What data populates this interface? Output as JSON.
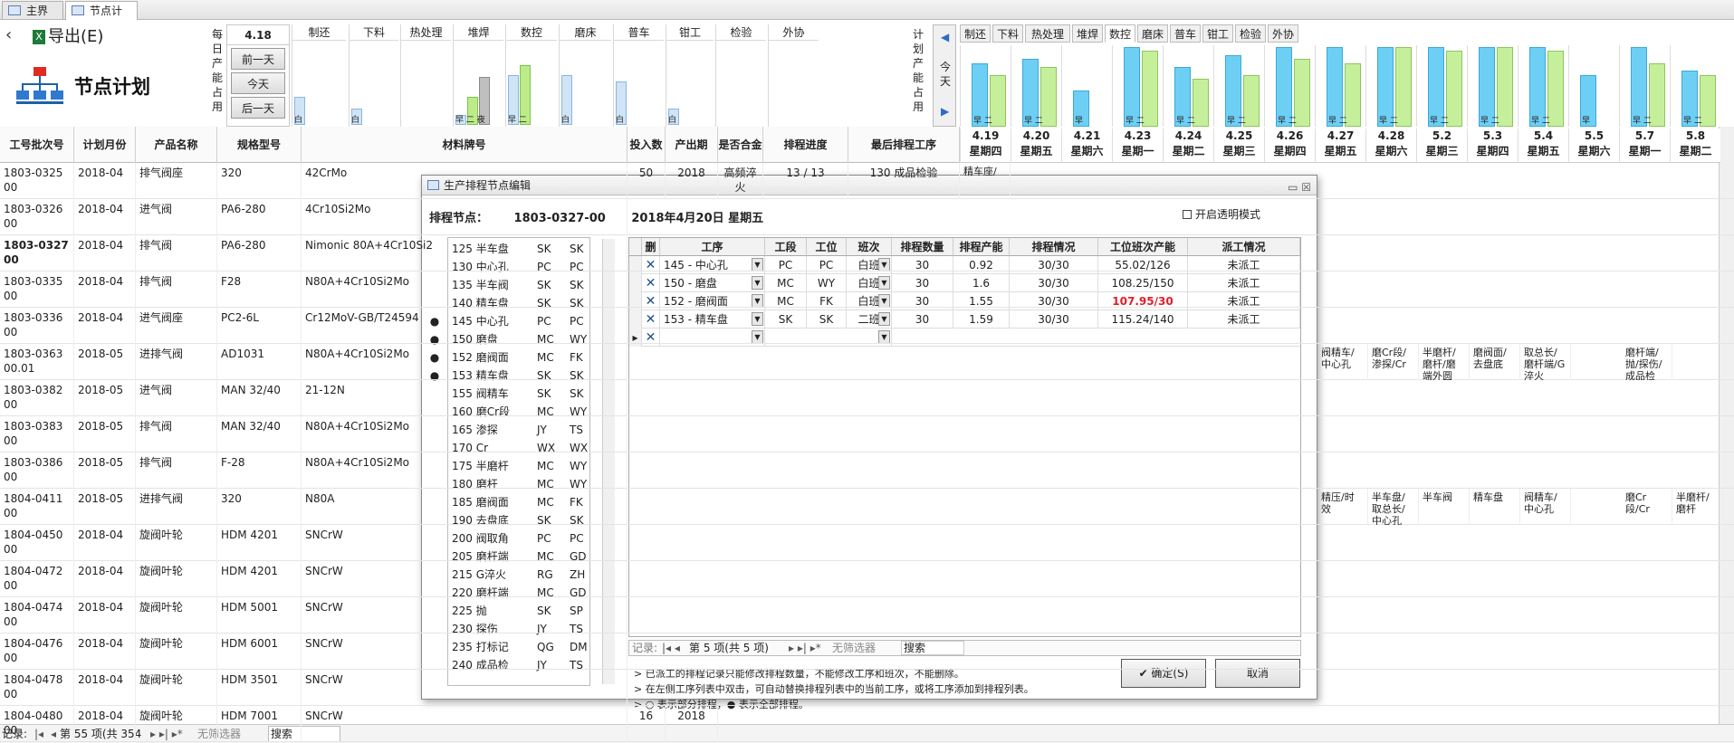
{
  "tabs": [
    {
      "label": "主界面",
      "active": false
    },
    {
      "label": "节点计划",
      "active": true
    }
  ],
  "toolbar": {
    "back_icon": "chevron-left-icon",
    "export_label": "导出(E)"
  },
  "page_title": "节点计划",
  "capacity": {
    "label_left": [
      "每",
      "日",
      "产",
      "能",
      "占",
      "用"
    ],
    "current_day": "4.18",
    "buttons": [
      "前一天",
      "今天",
      "后一天"
    ],
    "processes": [
      "制还",
      "下料",
      "热处理",
      "堆焊",
      "数控",
      "磨床",
      "普车",
      "钳工",
      "检验",
      "外协"
    ],
    "bars": [
      {
        "b": 0.35,
        "label": "白"
      },
      {
        "b": 0.2,
        "label": "白"
      },
      {
        "b": 0,
        "label": ""
      },
      {
        "b": 0.12,
        "g": 0.35,
        "gr": 0.6,
        "label": "早 二 夜"
      },
      {
        "b": 0.63,
        "g": 0.75,
        "label": "早 二"
      },
      {
        "b": 0.62,
        "label": "白"
      },
      {
        "b": 0.55,
        "label": "白"
      },
      {
        "b": 0.2,
        "label": "白"
      },
      {
        "b": 0,
        "label": ""
      },
      {
        "b": 0,
        "label": ""
      }
    ],
    "label_right": [
      "计",
      "划",
      "产",
      "能",
      "占",
      "用"
    ],
    "today_label": "今天"
  },
  "right_tabs": {
    "items": [
      "制还",
      "下料",
      "热处理",
      "堆焊",
      "数控",
      "磨床",
      "普车",
      "钳工",
      "检验",
      "外协"
    ],
    "active": "数控"
  },
  "date_columns": [
    {
      "date": "4.19",
      "weekday": "星期四",
      "b": 0.8,
      "g": 0.65,
      "label": "早 二"
    },
    {
      "date": "4.20",
      "weekday": "星期五",
      "b": 0.85,
      "g": 0.75,
      "label": "早 二"
    },
    {
      "date": "4.21",
      "weekday": "星期六",
      "b": 0.45,
      "g": 0,
      "label": "早"
    },
    {
      "date": "4.23",
      "weekday": "星期一",
      "b": 1.0,
      "g": 0.95,
      "label": "早 二"
    },
    {
      "date": "4.24",
      "weekday": "星期二",
      "b": 0.75,
      "g": 0.6,
      "label": "早 二"
    },
    {
      "date": "4.25",
      "weekday": "星期三",
      "b": 0.9,
      "g": 0.65,
      "label": "早 二"
    },
    {
      "date": "4.26",
      "weekday": "星期四",
      "b": 1.0,
      "g": 0.85,
      "label": "早 二"
    },
    {
      "date": "4.27",
      "weekday": "星期五",
      "b": 1.0,
      "g": 0.8,
      "label": "早 二"
    },
    {
      "date": "4.28",
      "weekday": "星期六",
      "b": 1.0,
      "g": 1.0,
      "label": "早 二"
    },
    {
      "date": "5.2",
      "weekday": "星期三",
      "b": 1.0,
      "g": 0.95,
      "label": "早 二"
    },
    {
      "date": "5.3",
      "weekday": "星期四",
      "b": 1.0,
      "g": 1.0,
      "label": "早 二"
    },
    {
      "date": "5.4",
      "weekday": "星期五",
      "b": 1.0,
      "g": 0.95,
      "label": "早 二"
    },
    {
      "date": "5.5",
      "weekday": "星期六",
      "b": 0.65,
      "g": 0,
      "label": "早"
    },
    {
      "date": "5.7",
      "weekday": "星期一",
      "b": 1.0,
      "g": 0.8,
      "label": "早 二"
    },
    {
      "date": "5.8",
      "weekday": "星期二",
      "b": 0.7,
      "g": 0.65,
      "label": "早 二"
    }
  ],
  "grid": {
    "headers": [
      "工号批次号",
      "计划月份",
      "产品名称",
      "规格型号",
      "材料牌号",
      "投入数",
      "产出期",
      "是否合金",
      "排程进度",
      "最后排程工序"
    ],
    "rows": [
      {
        "batch": "1803-0325 00",
        "month": "2018-04",
        "product": "排气阀座",
        "spec": "320",
        "material": "42CrMo",
        "qty": "50",
        "out": "2018",
        "alloy": "高频淬火",
        "progress": "13 / 13",
        "last": "130 成品检验",
        "bold": false,
        "extra": [
          "精车座/"
        ]
      },
      {
        "batch": "1803-0326 00",
        "month": "2018-04",
        "product": "进气阀",
        "spec": "PA6-280",
        "material": "4Cr10Si2Mo",
        "bold": false,
        "extra": []
      },
      {
        "batch": "1803-0327 00",
        "month": "2018-04",
        "product": "排气阀",
        "spec": "PA6-280",
        "material": "Nimonic 80A+4Cr10Si2",
        "bold": true,
        "extra": []
      },
      {
        "batch": "1803-0335 00",
        "month": "2018-04",
        "product": "排气阀",
        "spec": "F28",
        "material": "N80A+4Cr10Si2Mo",
        "bold": false,
        "extra": []
      },
      {
        "batch": "1803-0336 00",
        "month": "2018-04",
        "product": "进气阀座",
        "spec": "PC2-6L",
        "material": "Cr12MoV-GB/T24594",
        "bold": false,
        "extra": []
      },
      {
        "batch": "1803-0363 00.01",
        "month": "2018-05",
        "product": "进排气阀",
        "spec": "AD1031",
        "material": "N80A+4Cr10Si2Mo",
        "bold": false,
        "extra": [
          "阀精车/中心孔",
          "磨Cr段/渗探/Cr",
          "半磨杆/磨杆/磨端外圆",
          "磨阀面/去盘底",
          "取总长/磨杆端/G淬火",
          "",
          "磨杆端/抛/探伤/成品检"
        ]
      },
      {
        "batch": "1803-0382 00",
        "month": "2018-05",
        "product": "进气阀",
        "spec": "MAN 32/40",
        "material": "21-12N",
        "bold": false,
        "extra": []
      },
      {
        "batch": "1803-0383 00",
        "month": "2018-05",
        "product": "排气阀",
        "spec": "MAN 32/40",
        "material": "N80A+4Cr10Si2Mo",
        "bold": false,
        "extra": []
      },
      {
        "batch": "1803-0386 00",
        "month": "2018-05",
        "product": "排气阀",
        "spec": "F-28",
        "material": "N80A+4Cr10Si2Mo",
        "bold": false,
        "extra": []
      },
      {
        "batch": "1804-0411 00",
        "month": "2018-05",
        "product": "进排气阀",
        "spec": "320",
        "material": "N80A",
        "bold": false,
        "extra": [
          "精压/时效",
          "半车盘/取总长/中心孔",
          "半车阀",
          "精车盘",
          "阀精车/中心孔",
          "",
          "磨Cr段/Cr",
          "半磨杆/磨杆"
        ]
      },
      {
        "batch": "1804-0450 00",
        "month": "2018-04",
        "product": "旋阀叶轮",
        "spec": "HDM 4201",
        "material": "SNCrW",
        "bold": false,
        "extra": []
      },
      {
        "batch": "1804-0472 00",
        "month": "2018-04",
        "product": "旋阀叶轮",
        "spec": "HDM 4201",
        "material": "SNCrW",
        "bold": false,
        "extra": []
      },
      {
        "batch": "1804-0474 00",
        "month": "2018-04",
        "product": "旋阀叶轮",
        "spec": "HDM 5001",
        "material": "SNCrW",
        "bold": false,
        "extra": []
      },
      {
        "batch": "1804-0476 00",
        "month": "2018-04",
        "product": "旋阀叶轮",
        "spec": "HDM 6001",
        "material": "SNCrW",
        "bold": false,
        "extra": []
      },
      {
        "batch": "1804-0478 00",
        "month": "2018-04",
        "product": "旋阀叶轮",
        "spec": "HDM 3501",
        "material": "SNCrW",
        "bold": false,
        "extra": []
      },
      {
        "batch": "1804-0480 00",
        "month": "2018-04",
        "product": "旋阀叶轮",
        "spec": "HDM 7001",
        "material": "SNCrW",
        "qty": "16",
        "out": "2018",
        "bold": false,
        "extra": []
      }
    ]
  },
  "status": {
    "record_label": "记录:",
    "nav_text": "第 55 项(共 354",
    "filter": "无筛选器",
    "search": "搜索"
  },
  "dialog": {
    "title": "生产排程节点编辑",
    "node_label": "排程节点：",
    "node_id": "1803-0327-00",
    "node_date": "2018年4月20日 星期五",
    "transparent_label": "开启透明模式",
    "process_list": [
      {
        "dot": "",
        "name": "125 半车盘",
        "a": "SK",
        "b": "SK"
      },
      {
        "dot": "",
        "name": "130 中心孔",
        "a": "PC",
        "b": "PC"
      },
      {
        "dot": "",
        "name": "135 半车阀",
        "a": "SK",
        "b": "SK"
      },
      {
        "dot": "",
        "name": "140 精车盘",
        "a": "SK",
        "b": "SK"
      },
      {
        "dot": "●",
        "name": "145 中心孔",
        "a": "PC",
        "b": "PC"
      },
      {
        "dot": "●",
        "name": "150 磨盘",
        "a": "MC",
        "b": "WY"
      },
      {
        "dot": "●",
        "name": "152 磨阀面",
        "a": "MC",
        "b": "FK"
      },
      {
        "dot": "●",
        "name": "153 精车盘",
        "a": "SK",
        "b": "SK"
      },
      {
        "dot": "",
        "name": "155 阀精车",
        "a": "SK",
        "b": "SK"
      },
      {
        "dot": "",
        "name": "160 磨Cr段",
        "a": "MC",
        "b": "WY"
      },
      {
        "dot": "",
        "name": "165 渗探",
        "a": "JY",
        "b": "TS"
      },
      {
        "dot": "",
        "name": "170 Cr",
        "a": "WX",
        "b": "WX"
      },
      {
        "dot": "",
        "name": "175 半磨杆",
        "a": "MC",
        "b": "WY"
      },
      {
        "dot": "",
        "name": "180 磨杆",
        "a": "MC",
        "b": "WY"
      },
      {
        "dot": "",
        "name": "185 磨阀面",
        "a": "MC",
        "b": "FK"
      },
      {
        "dot": "",
        "name": "190 去盘底",
        "a": "SK",
        "b": "SK"
      },
      {
        "dot": "",
        "name": "200 阀取角",
        "a": "PC",
        "b": "PC"
      },
      {
        "dot": "",
        "name": "205 磨杆端",
        "a": "MC",
        "b": "GD"
      },
      {
        "dot": "",
        "name": "215 G淬火",
        "a": "RG",
        "b": "ZH"
      },
      {
        "dot": "",
        "name": "220 磨杆端",
        "a": "MC",
        "b": "GD"
      },
      {
        "dot": "",
        "name": "225 抛",
        "a": "SK",
        "b": "SP"
      },
      {
        "dot": "",
        "name": "230 探伤",
        "a": "JY",
        "b": "TS"
      },
      {
        "dot": "",
        "name": "235 打标记",
        "a": "QG",
        "b": "DM"
      },
      {
        "dot": "",
        "name": "240 成品检",
        "a": "JY",
        "b": "TS"
      }
    ],
    "sub_headers": [
      "删",
      "工序",
      "工段",
      "工位",
      "班次",
      "排程数量",
      "排程产能",
      "排程情况",
      "工位班次产能",
      "派工情况"
    ],
    "sub_rows": [
      {
        "proc": "145 - 中心孔",
        "section": "PC",
        "station": "PC",
        "shift": "白班",
        "qty": "30",
        "cap": "0.92",
        "status": "30/30",
        "station_cap": "55.02/126",
        "dispatch": "未派工",
        "warn": false
      },
      {
        "proc": "150 - 磨盘",
        "section": "MC",
        "station": "WY",
        "shift": "白班",
        "qty": "30",
        "cap": "1.6",
        "status": "30/30",
        "station_cap": "108.25/150",
        "dispatch": "未派工",
        "warn": false
      },
      {
        "proc": "152 - 磨阀面",
        "section": "MC",
        "station": "FK",
        "shift": "白班",
        "qty": "30",
        "cap": "1.55",
        "status": "30/30",
        "station_cap": "107.95/30",
        "dispatch": "未派工",
        "warn": true
      },
      {
        "proc": "153 - 精车盘",
        "section": "SK",
        "station": "SK",
        "shift": "二班",
        "qty": "30",
        "cap": "1.59",
        "status": "30/30",
        "station_cap": "115.24/140",
        "dispatch": "未派工",
        "warn": false
      }
    ],
    "sub_nav": {
      "record": "记录:",
      "page": "第 5 项(共 5 项)",
      "filter": "无筛选器",
      "search": "搜索"
    },
    "notes": [
      "> 已派工的排程记录只能修改排程数量，不能修改工序和班次，不能删除。",
      "> 在左侧工序列表中双击，可自动替换排程列表中的当前工序，或将工序添加到排程列表。",
      "> ○ 表示部分排程，● 表示全部排程。"
    ],
    "ok_label": "✔ 确定(S)",
    "cancel_label": "取消"
  },
  "colors": {
    "blue_bar": "#6ecff5",
    "green_bar": "#c6ef9c",
    "warn": "#e0202a"
  }
}
